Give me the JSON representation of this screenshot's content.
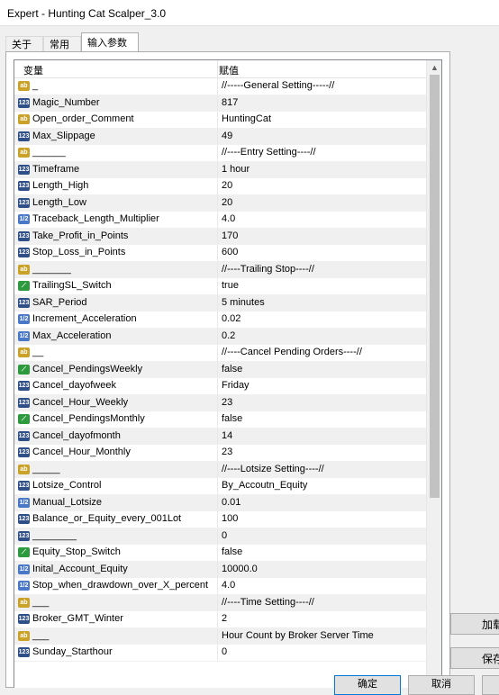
{
  "window": {
    "title": "Expert - Hunting Cat Scalper_3.0"
  },
  "tabs": [
    {
      "label": "关于"
    },
    {
      "label": "常用"
    },
    {
      "label": "输入参数"
    }
  ],
  "grid": {
    "headers": {
      "variable": "变量",
      "value": "赋值"
    },
    "rows": [
      {
        "type": "ab",
        "name": "_",
        "value": "//-----General Setting-----//"
      },
      {
        "type": "int",
        "name": "Magic_Number",
        "value": "817"
      },
      {
        "type": "ab",
        "name": "Open_order_Comment",
        "value": "HuntingCat"
      },
      {
        "type": "int",
        "name": "Max_Slippage",
        "value": "49"
      },
      {
        "type": "ab",
        "name": "______",
        "value": "//----Entry Setting----//"
      },
      {
        "type": "int",
        "name": "Timeframe",
        "value": "1 hour"
      },
      {
        "type": "int",
        "name": "Length_High",
        "value": "20"
      },
      {
        "type": "int",
        "name": "Length_Low",
        "value": "20"
      },
      {
        "type": "dbl",
        "name": "Traceback_Length_Multiplier",
        "value": "4.0"
      },
      {
        "type": "int",
        "name": "Take_Profit_in_Points",
        "value": "170"
      },
      {
        "type": "int",
        "name": "Stop_Loss_in_Points",
        "value": "600"
      },
      {
        "type": "ab",
        "name": "_______",
        "value": "//----Trailing Stop----//"
      },
      {
        "type": "bool",
        "name": "TrailingSL_Switch",
        "value": "true"
      },
      {
        "type": "int",
        "name": "SAR_Period",
        "value": "5 minutes"
      },
      {
        "type": "dbl",
        "name": "Increment_Acceleration",
        "value": "0.02"
      },
      {
        "type": "dbl",
        "name": "Max_Acceleration",
        "value": "0.2"
      },
      {
        "type": "ab",
        "name": "__",
        "value": "//----Cancel Pending Orders----//"
      },
      {
        "type": "bool",
        "name": "Cancel_PendingsWeekly",
        "value": "false"
      },
      {
        "type": "int",
        "name": "Cancel_dayofweek",
        "value": "Friday"
      },
      {
        "type": "int",
        "name": "Cancel_Hour_Weekly",
        "value": "23"
      },
      {
        "type": "bool",
        "name": "Cancel_PendingsMonthly",
        "value": "false"
      },
      {
        "type": "int",
        "name": "Cancel_dayofmonth",
        "value": "14"
      },
      {
        "type": "int",
        "name": "Cancel_Hour_Monthly",
        "value": "23"
      },
      {
        "type": "ab",
        "name": "_____",
        "value": "//----Lotsize Setting----//"
      },
      {
        "type": "int",
        "name": "Lotsize_Control",
        "value": "By_Accoutn_Equity"
      },
      {
        "type": "dbl",
        "name": "Manual_Lotsize",
        "value": "0.01"
      },
      {
        "type": "int",
        "name": "Balance_or_Equity_every_001Lot",
        "value": "100"
      },
      {
        "type": "int",
        "name": "________",
        "value": "0"
      },
      {
        "type": "bool",
        "name": "Equity_Stop_Switch",
        "value": "false"
      },
      {
        "type": "dbl",
        "name": "Inital_Account_Equity",
        "value": "10000.0"
      },
      {
        "type": "dbl",
        "name": "Stop_when_drawdown_over_X_percent",
        "value": "4.0"
      },
      {
        "type": "ab",
        "name": "___",
        "value": "//----Time Setting----//"
      },
      {
        "type": "int",
        "name": "Broker_GMT_Winter",
        "value": "2"
      },
      {
        "type": "ab",
        "name": "___",
        "value": "Hour Count by Broker Server Time"
      },
      {
        "type": "int",
        "name": "Sunday_Starthour",
        "value": "0"
      }
    ]
  },
  "side_buttons": {
    "load_partial": "加载",
    "save_partial": "保存"
  },
  "bottom_buttons": {
    "ok_partial": "确定",
    "cancel_partial": "取消"
  },
  "icons": {
    "ab": "ab",
    "int": "123",
    "dbl": "1/2",
    "bool": "chart"
  }
}
